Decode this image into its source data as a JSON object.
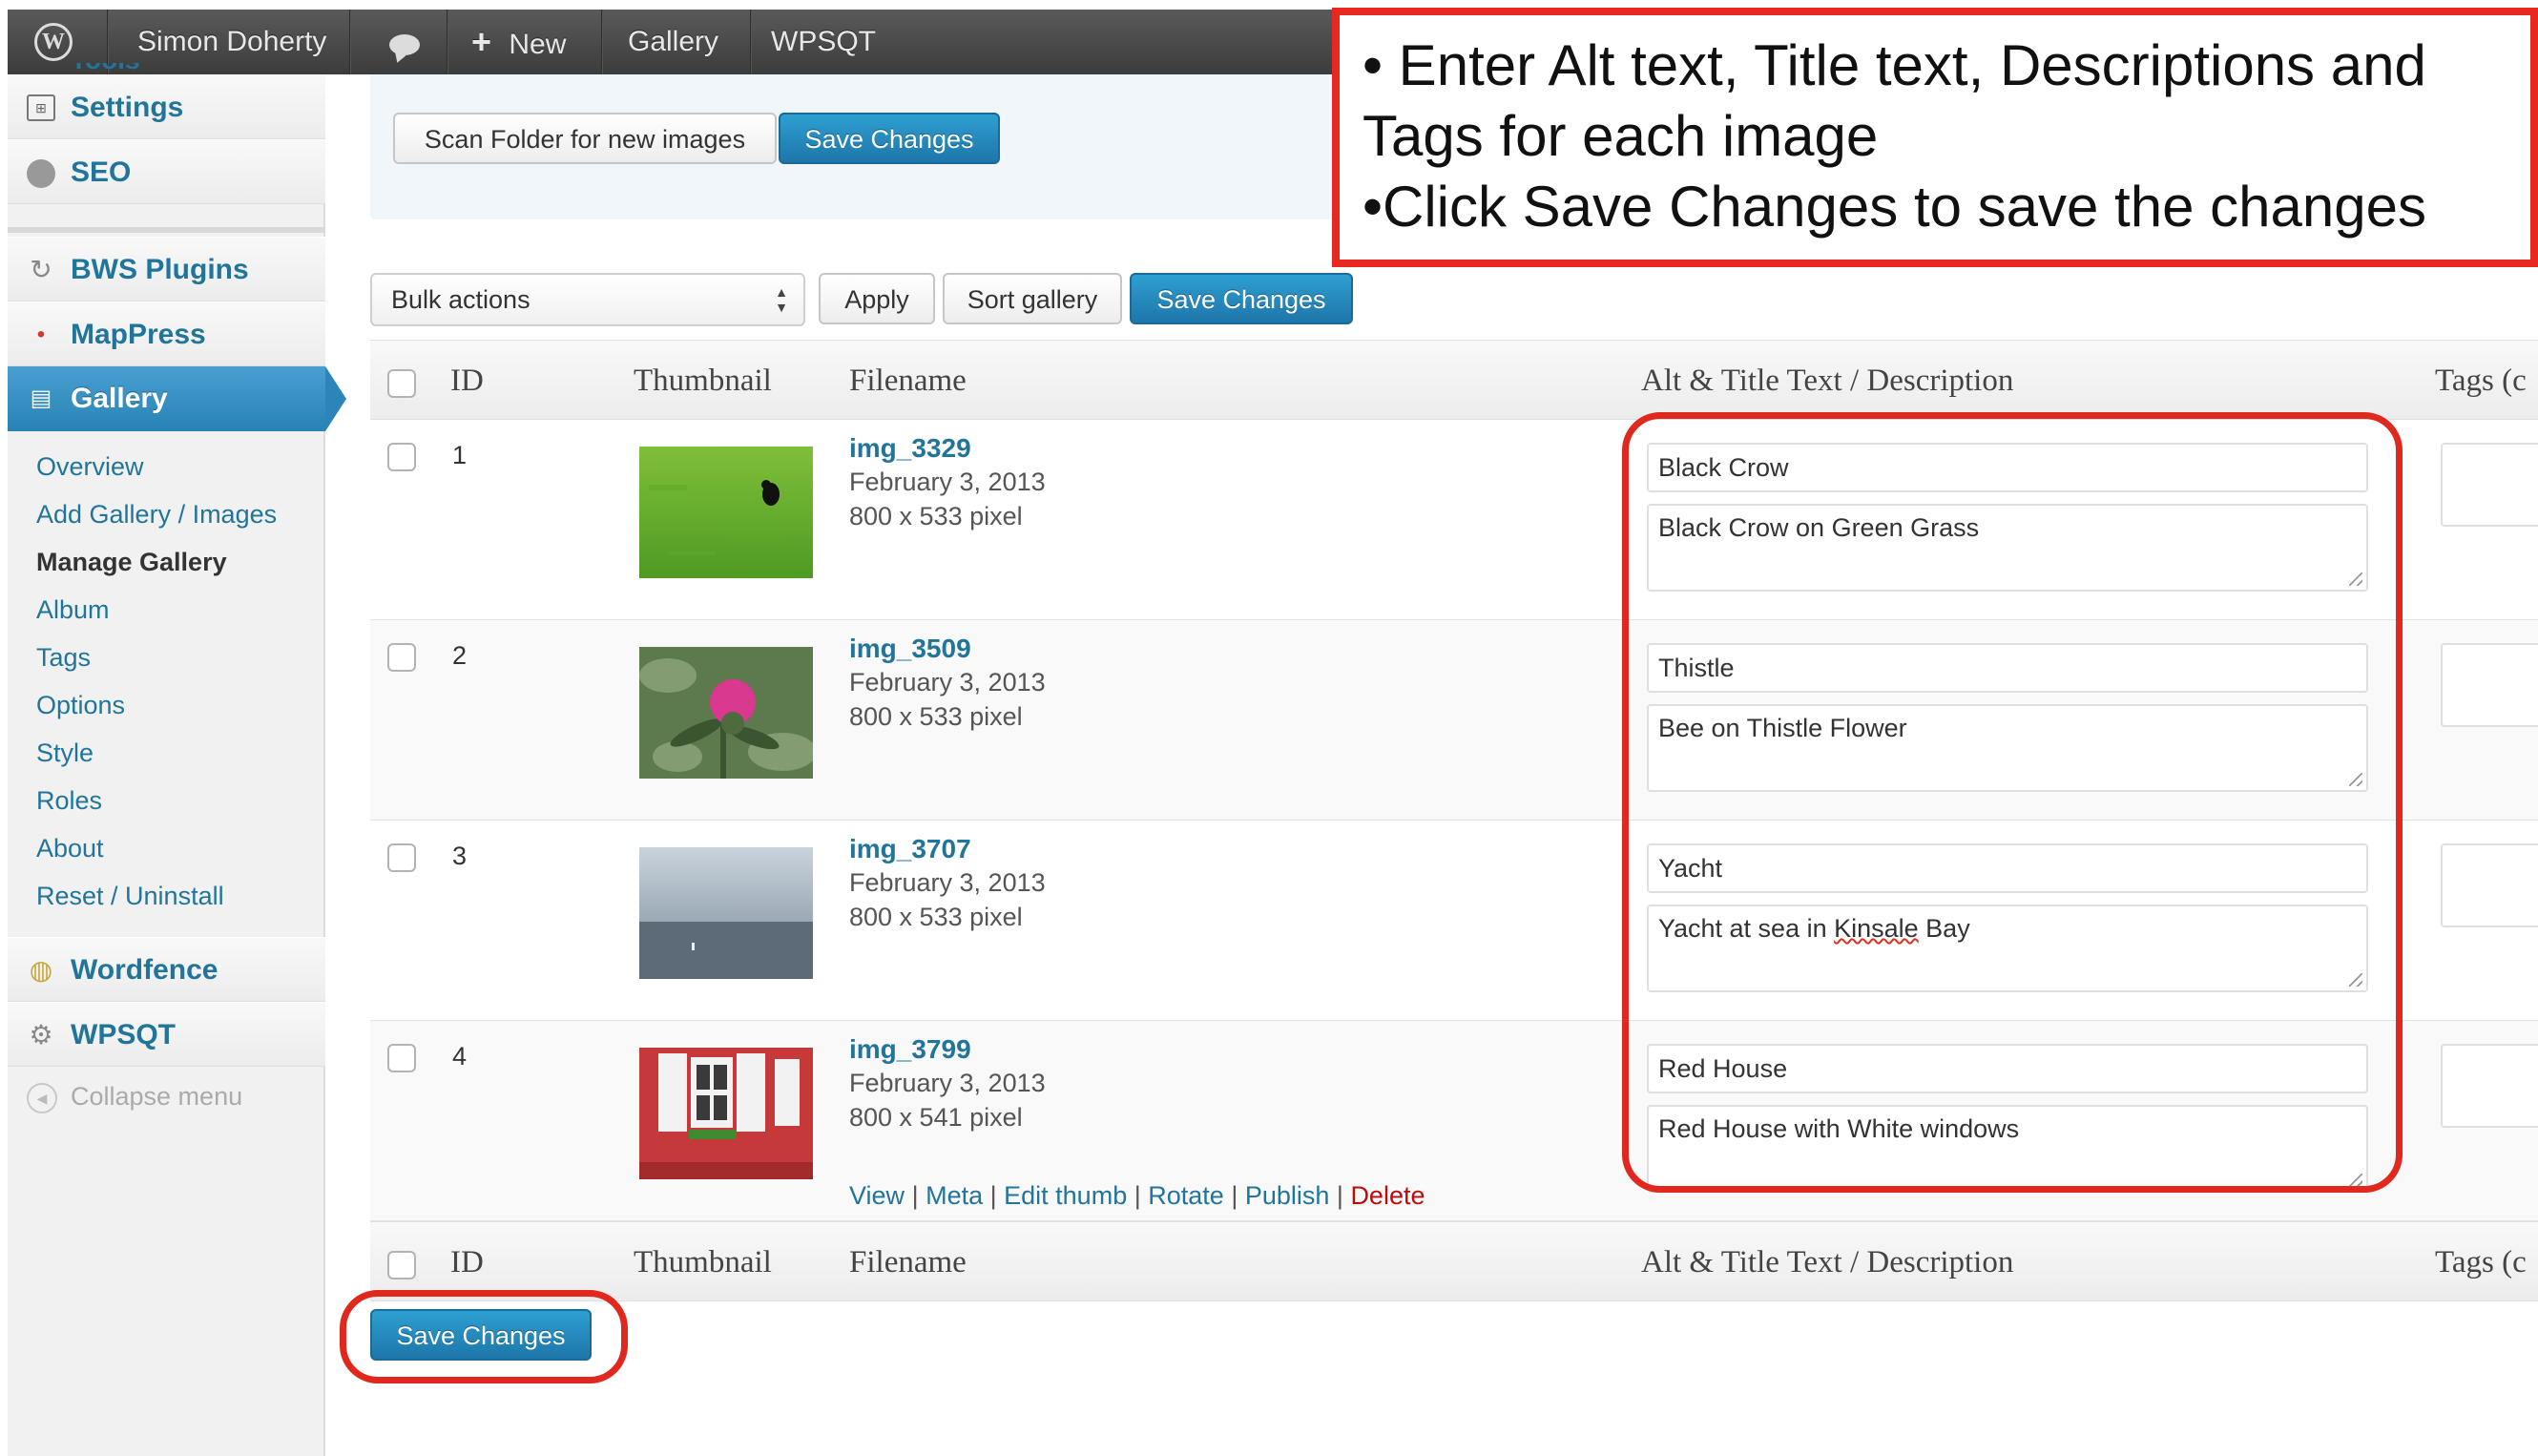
{
  "admin_bar": {
    "user": "Simon Doherty",
    "new_label": "New",
    "gallery_label": "Gallery",
    "wpsqt_label": "WPSQT"
  },
  "sidebar": {
    "partial_item": "Tools",
    "menu": [
      {
        "label": "Settings",
        "icon": "settings-icon"
      },
      {
        "label": "SEO",
        "icon": "seo-icon"
      },
      {
        "label": "BWS Plugins",
        "icon": "bws-plugins-icon"
      },
      {
        "label": "MapPress",
        "icon": "map-pin-icon"
      },
      {
        "label": "Gallery",
        "icon": "gallery-icon",
        "current": true
      }
    ],
    "submenu": [
      {
        "label": "Overview"
      },
      {
        "label": "Add Gallery / Images"
      },
      {
        "label": "Manage Gallery",
        "active": true
      },
      {
        "label": "Album"
      },
      {
        "label": "Tags"
      },
      {
        "label": "Options"
      },
      {
        "label": "Style"
      },
      {
        "label": "Roles"
      },
      {
        "label": "About"
      },
      {
        "label": "Reset / Uninstall"
      }
    ],
    "menu_after": [
      {
        "label": "Wordfence",
        "icon": "wordfence-icon"
      },
      {
        "label": "WPSQT",
        "icon": "gear-icon"
      }
    ],
    "collapse_label": "Collapse menu"
  },
  "top_panel": {
    "scan_label": "Scan Folder for new images",
    "save_label": "Save Changes"
  },
  "toolbar": {
    "bulk_actions": "Bulk actions",
    "apply_label": "Apply",
    "sort_label": "Sort gallery",
    "save_label": "Save Changes"
  },
  "table": {
    "columns": [
      "ID",
      "Thumbnail",
      "Filename",
      "Alt & Title Text / Description",
      "Tags (c"
    ],
    "rows": [
      {
        "id": "1",
        "filename": "img_3329",
        "date": "February 3, 2013",
        "size": "800 x 533 pixel",
        "alt": "Black Crow",
        "description": "Black Crow on Green Grass",
        "thumb": "crow-on-grass"
      },
      {
        "id": "2",
        "filename": "img_3509",
        "date": "February 3, 2013",
        "size": "800 x 533 pixel",
        "alt": "Thistle",
        "description": "Bee on Thistle Flower",
        "thumb": "thistle-flower"
      },
      {
        "id": "3",
        "filename": "img_3707",
        "date": "February 3, 2013",
        "size": "800 x 533 pixel",
        "alt": "Yacht",
        "description_before": "Yacht at sea in ",
        "description_misspelled": "Kinsale",
        "description_after": " Bay",
        "thumb": "yacht-at-sea"
      },
      {
        "id": "4",
        "filename": "img_3799",
        "date": "February 3, 2013",
        "size": "800 x 541 pixel",
        "alt": "Red House",
        "description": "Red House with White windows",
        "thumb": "red-house"
      }
    ],
    "row_actions": [
      "View",
      "Meta",
      "Edit thumb",
      "Rotate",
      "Publish",
      "Delete"
    ]
  },
  "bottom": {
    "save_label": "Save Changes"
  },
  "annotation": {
    "line1": "• Enter Alt text, Title text, Descriptions and",
    "line2": "Tags for each image",
    "line3": "•Click Save Changes to save the changes",
    "color": "#e0281e"
  },
  "colors": {
    "admin_bar": "#464646",
    "accent": "#21759b",
    "primary_button": "#2188c1",
    "current_menu": "#2e88bd",
    "delete": "#bc0b0b"
  }
}
